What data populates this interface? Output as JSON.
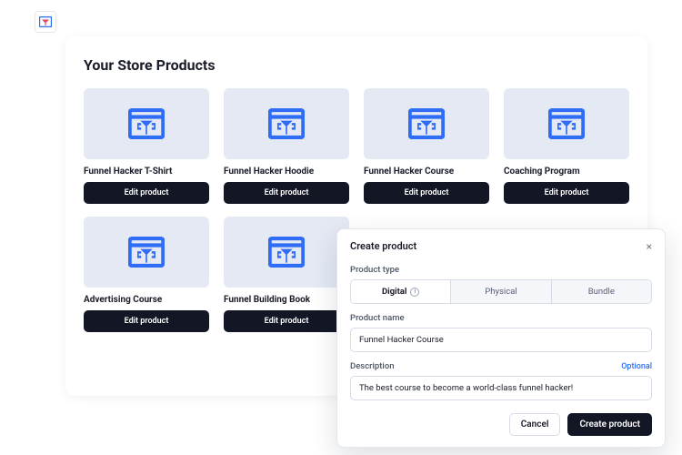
{
  "brand": {
    "logo_name": "funnel-logo"
  },
  "page": {
    "title": "Your Store Products",
    "edit_label": "Edit product"
  },
  "products": [
    {
      "title": "Funnel Hacker T-Shirt"
    },
    {
      "title": "Funnel Hacker Hoodie"
    },
    {
      "title": "Funnel Hacker Course"
    },
    {
      "title": "Coaching Program"
    },
    {
      "title": "Advertising Course"
    },
    {
      "title": "Funnel Building Book"
    }
  ],
  "modal": {
    "title": "Create product",
    "product_type_label": "Product type",
    "types": {
      "digital": "Digital",
      "physical": "Physical",
      "bundle": "Bundle"
    },
    "product_name_label": "Product name",
    "product_name_value": "Funnel Hacker Course",
    "description_label": "Description",
    "description_value": "The best course to become a world-class funnel hacker!",
    "optional_label": "Optional",
    "cancel_label": "Cancel",
    "create_label": "Create product"
  },
  "colors": {
    "accent": "#2f6df6",
    "dark": "#131725",
    "thumb_bg": "#e4e9f4"
  }
}
